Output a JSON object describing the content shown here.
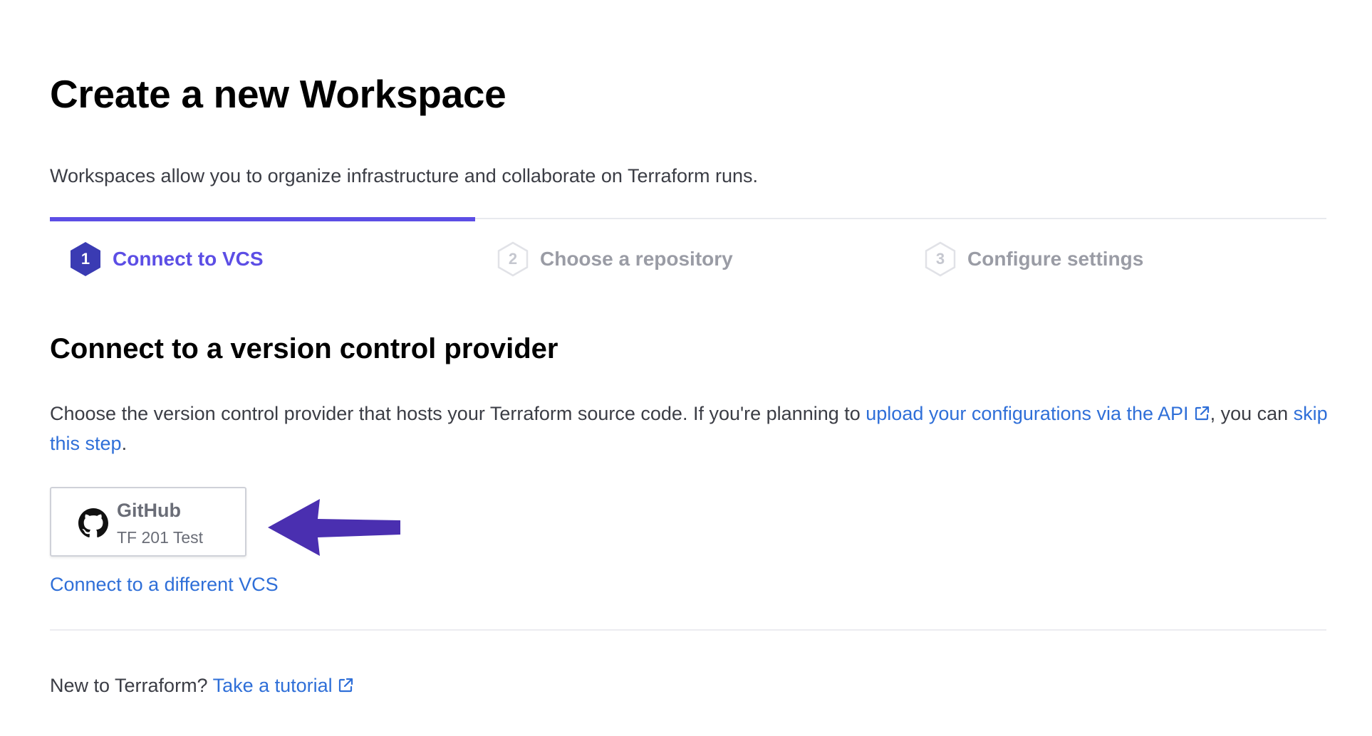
{
  "page": {
    "title": "Create a new Workspace",
    "subtitle": "Workspaces allow you to organize infrastructure and collaborate on Terraform runs."
  },
  "steps": {
    "progress_percent": 33.3,
    "items": [
      {
        "number": "1",
        "label": "Connect to VCS",
        "state": "active"
      },
      {
        "number": "2",
        "label": "Choose a repository",
        "state": "inactive"
      },
      {
        "number": "3",
        "label": "Configure settings",
        "state": "inactive"
      }
    ]
  },
  "section": {
    "title": "Connect to a version control provider",
    "desc_prefix": "Choose the version control provider that hosts your Terraform source code. If you're planning to ",
    "api_link": "upload your configurations via the API",
    "desc_middle": ", you can ",
    "skip_link": "skip this step",
    "desc_suffix": "."
  },
  "provider": {
    "name": "GitHub",
    "account": "TF 201 Test",
    "icon": "github-icon"
  },
  "different_vcs_link": "Connect to a different VCS",
  "footer": {
    "prefix": "New to Terraform? ",
    "tutorial_link": "Take a tutorial"
  },
  "colors": {
    "accent": "#5c4ee5",
    "active_badge": "#3a3bb3",
    "link": "#2f6fd8",
    "annotation_arrow": "#4a2fb0"
  }
}
